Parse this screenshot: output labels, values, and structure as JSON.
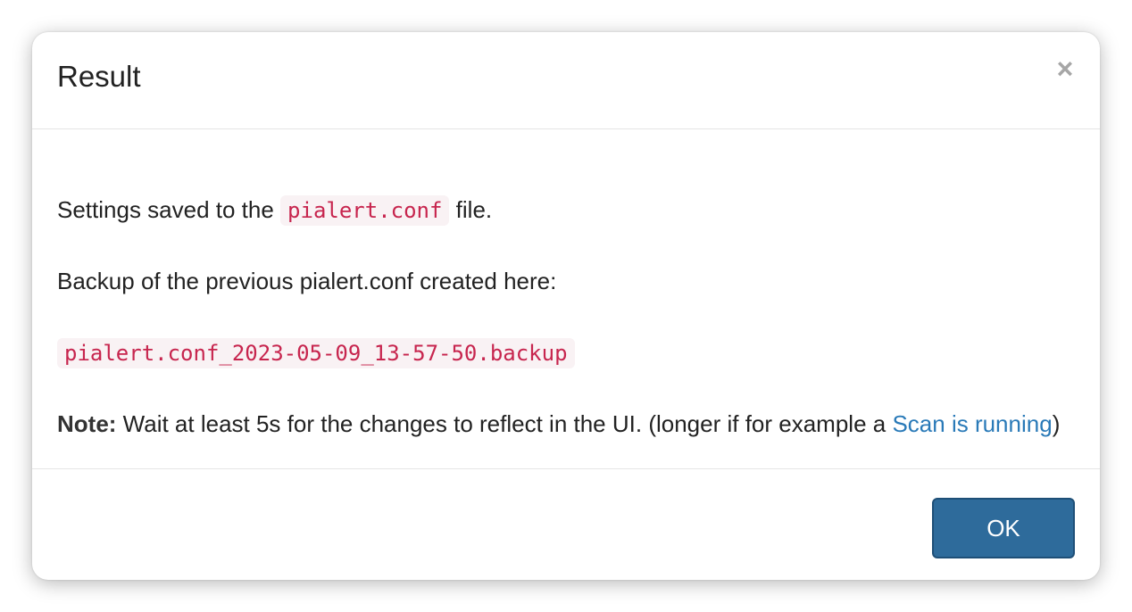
{
  "modal": {
    "title": "Result",
    "close_symbol": "×",
    "body": {
      "line1_prefix": "Settings saved to the ",
      "line1_code": "pialert.conf",
      "line1_suffix": " file.",
      "line2": "Backup of the previous pialert.conf created here:",
      "backup_filename": "pialert.conf_2023-05-09_13-57-50.backup",
      "note_label": "Note:",
      "note_text": " Wait at least 5s for the changes to reflect in the UI. (longer if for example a ",
      "note_link": "Scan is running",
      "note_end": ")"
    },
    "footer": {
      "ok_label": "OK"
    }
  },
  "colors": {
    "code_text": "#c7254e",
    "code_bg": "#f9f2f4",
    "link": "#2a7ab8",
    "ok_button": "#2e6b9b"
  },
  "icons": {
    "close": "close-icon"
  }
}
